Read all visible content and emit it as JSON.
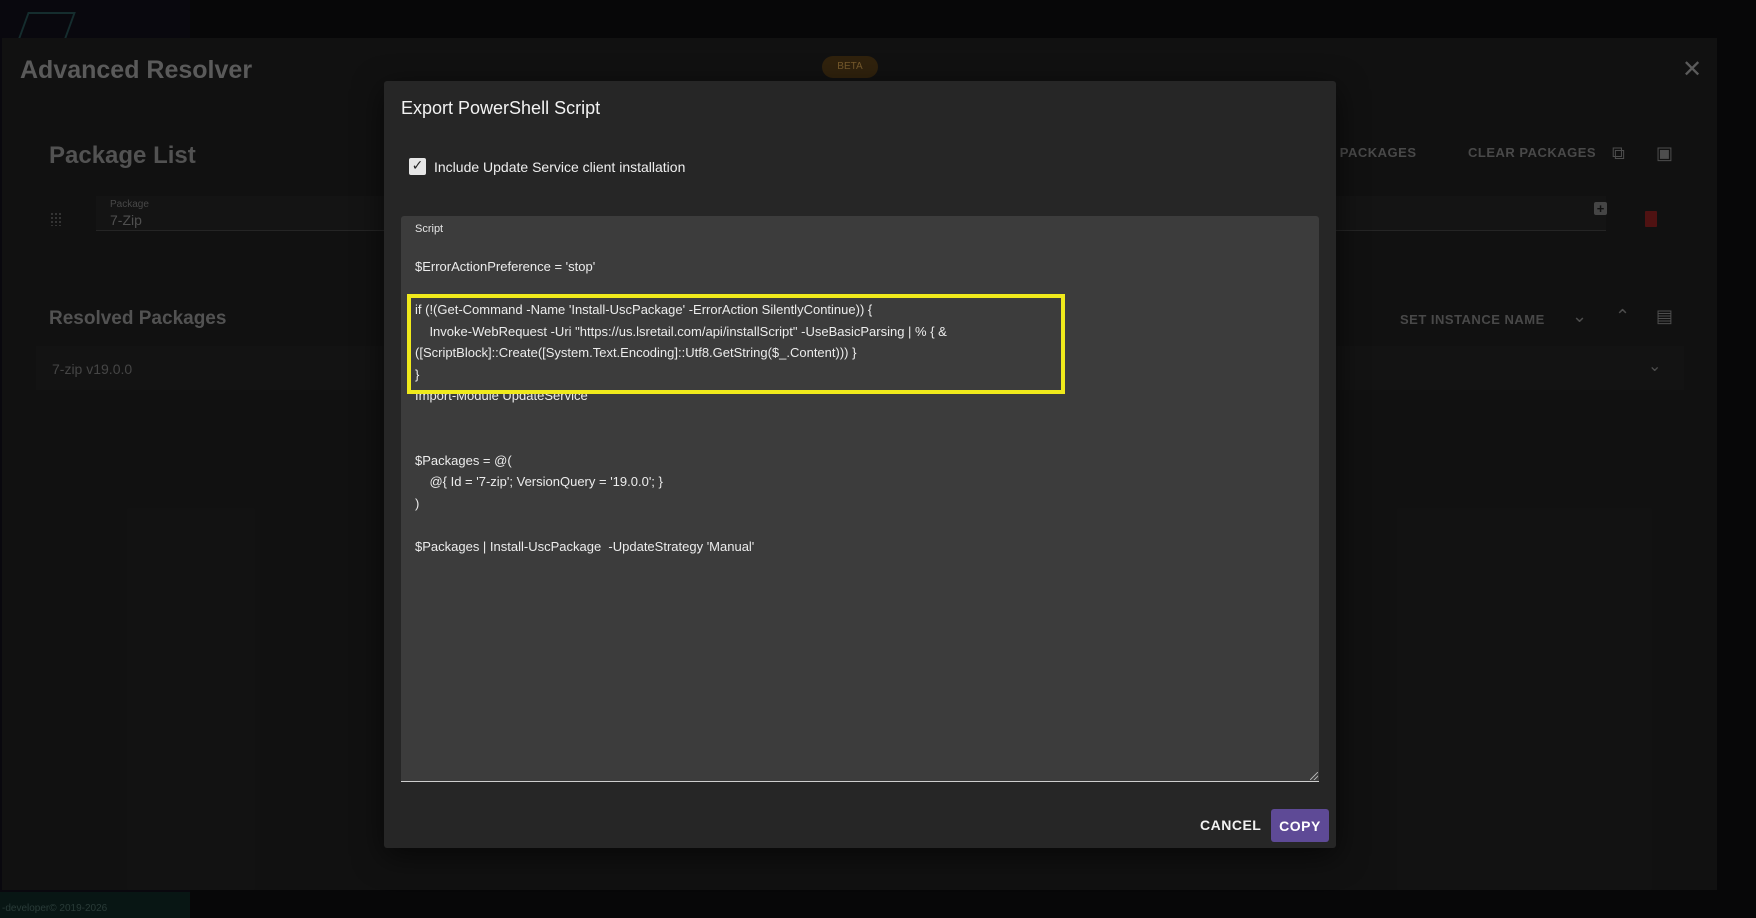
{
  "app": {
    "title": "Advanced Resolver",
    "beta_badge": "BETA",
    "close_icon": "close-icon",
    "footer": "-developer© 2019-2026"
  },
  "package_list": {
    "title": "Package List",
    "add_packages": "ADD PACKAGES",
    "clear_packages": "CLEAR PACKAGES",
    "field_label": "Package",
    "field_value": "7-Zip"
  },
  "resolved": {
    "title": "Resolved Packages",
    "set_instance_name": "SET INSTANCE NAME",
    "item": "7-zip v19.0.0"
  },
  "dialog": {
    "title": "Export PowerShell Script",
    "checkbox_label": "Include Update Service client installation",
    "checkbox_checked": true,
    "script_label": "Script",
    "code_lines": [
      "$ErrorActionPreference = 'stop'",
      "",
      "if (!(Get-Command -Name 'Install-UscPackage' -ErrorAction SilentlyContinue)) {",
      "    Invoke-WebRequest -Uri \"https://us.lsretail.com/api/installScript\" -UseBasicParsing | % { &",
      "([ScriptBlock]::Create([System.Text.Encoding]::Utf8.GetString($_.Content))) }",
      "}",
      "Import-Module UpdateService",
      "",
      "",
      "$Packages = @(",
      "    @{ Id = '7-zip'; VersionQuery = '19.0.0'; }",
      ")",
      "",
      "$Packages | Install-UscPackage  -UpdateStrategy 'Manual'"
    ],
    "cancel_label": "CANCEL",
    "copy_label": "COPY"
  },
  "colors": {
    "accent": "#5e4a96",
    "highlight": "#f0ea1b",
    "dialog_bg": "#262626",
    "script_bg": "#3c3c3c"
  }
}
